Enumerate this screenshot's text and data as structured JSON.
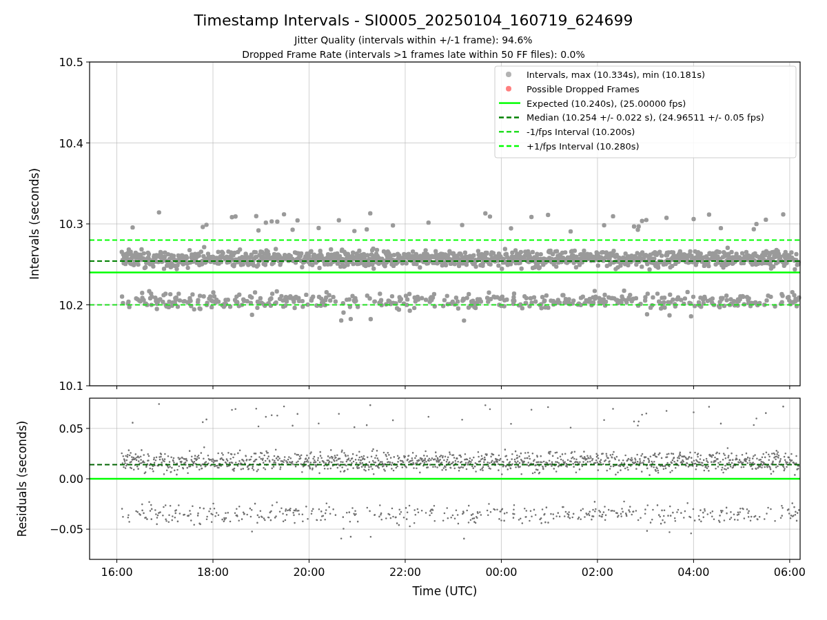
{
  "figure": {
    "title": "Timestamp Intervals - SI0005_20250104_160719_624699",
    "subtitles": [
      "Jitter Quality (intervals within +/-1 frame): 94.6%",
      "Dropped Frame Rate (intervals >1 frames late within 50 FF files): 0.0%"
    ]
  },
  "intervals_plot": {
    "legend_markers": [
      {
        "label": "Intervals, max (10.334s), min (10.181s)",
        "color": "#b3b3b3"
      },
      {
        "label": "Possible Dropped Frames",
        "color": "#ff7f7f"
      }
    ],
    "chart_data": {
      "type": "line",
      "ylabel": "Intervals (seconds)",
      "grid": true,
      "legend": true,
      "x": [
        "2025-01-04T15:26",
        "2025-01-05T06:13"
      ],
      "xlim": [
        "2025-01-04T15:26",
        "2025-01-05T06:13"
      ],
      "ylim": [
        10.1,
        10.5
      ],
      "yticks": [
        {
          "value": 10.1,
          "label": "10.1"
        },
        {
          "value": 10.2,
          "label": "10.2"
        },
        {
          "value": 10.3,
          "label": "10.3"
        },
        {
          "value": 10.4,
          "label": "10.4"
        },
        {
          "value": 10.5,
          "label": "10.5"
        }
      ],
      "series": [
        {
          "name": "Expected (10.240s), (25.00000 fps)",
          "color": "#00ff00",
          "line_style": "solid",
          "values": [
            10.24,
            10.24
          ]
        },
        {
          "name": "Median (10.254 +/- 0.022 s), (24.96511 +/- 0.05 fps)",
          "color": "#008000",
          "line_style": "dashed",
          "values": [
            10.254,
            10.254
          ]
        },
        {
          "name": "-1/fps Interval (10.200s)",
          "color": "#22dd22",
          "line_style": "dashed",
          "values": [
            10.2,
            10.2
          ]
        },
        {
          "name": "+1/fps Interval (10.280s)",
          "color": "#00ff00",
          "line_style": "dashed",
          "values": [
            10.28,
            10.28
          ]
        }
      ]
    }
  },
  "residuals_plot": {
    "chart_data": {
      "type": "line",
      "xlabel": "Time (UTC)",
      "ylabel": "Residuals (seconds)",
      "grid": true,
      "x": [
        "2025-01-04T15:26",
        "2025-01-05T06:13"
      ],
      "xlim": [
        "2025-01-04T15:26",
        "2025-01-05T06:13"
      ],
      "ylim": [
        -0.08,
        0.08
      ],
      "xticks": [
        {
          "value": "2025-01-04T16:00",
          "label": "16:00"
        },
        {
          "value": "2025-01-04T18:00",
          "label": "18:00"
        },
        {
          "value": "2025-01-04T20:00",
          "label": "20:00"
        },
        {
          "value": "2025-01-04T22:00",
          "label": "22:00"
        },
        {
          "value": "2025-01-05T00:00",
          "label": "00:00"
        },
        {
          "value": "2025-01-05T02:00",
          "label": "02:00"
        },
        {
          "value": "2025-01-05T04:00",
          "label": "04:00"
        },
        {
          "value": "2025-01-05T06:00",
          "label": "06:00"
        }
      ],
      "yticks": [
        {
          "value": -0.05,
          "label": "−0.05"
        },
        {
          "value": 0,
          "label": "0.00"
        },
        {
          "value": 0.05,
          "label": "0.05"
        }
      ],
      "series": [
        {
          "color": "#00ff00",
          "line_style": "solid",
          "values": [
            0,
            0
          ]
        },
        {
          "color": "#006400",
          "line_style": "dashed",
          "values": [
            0.014,
            0.014
          ]
        }
      ]
    }
  }
}
